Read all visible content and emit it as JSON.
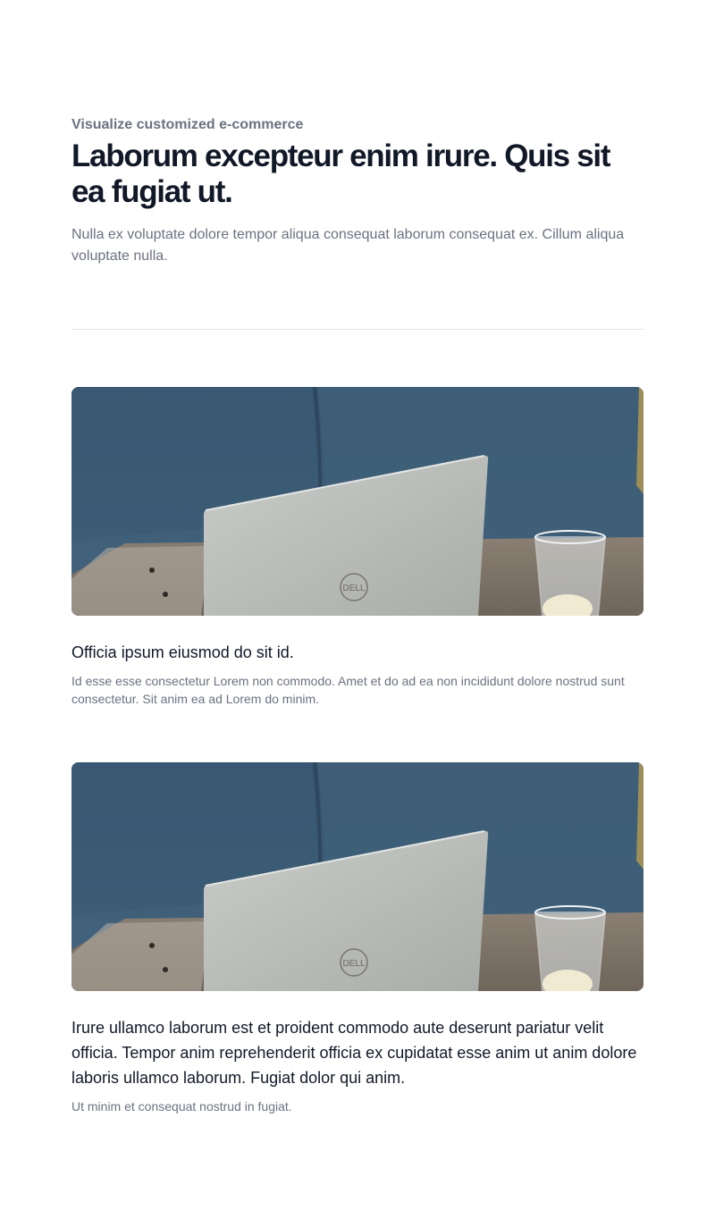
{
  "header": {
    "eyebrow": "Visualize customized e-commerce",
    "title": "Laborum excepteur enim irure. Quis sit ea fugiat ut.",
    "description": "Nulla ex voluptate dolore tempor aliqua consequat laborum consequat ex. Cillum aliqua voluptate nulla."
  },
  "cards": [
    {
      "image_logo_text": "DELL",
      "title": "Officia ipsum eiusmod do sit id.",
      "description": "Id esse esse consectetur Lorem non commodo. Amet et do ad ea non incididunt dolore nostrud sunt consectetur. Sit anim ea ad Lorem do minim."
    },
    {
      "image_logo_text": "DELL",
      "title": "Irure ullamco laborum est et proident commodo aute deserunt pariatur velit officia. Tempor anim reprehenderit officia ex cupidatat esse anim ut anim dolore laboris ullamco laborum. Fugiat dolor qui anim.",
      "description": "Ut minim et consequat nostrud in fugiat."
    }
  ],
  "colors": {
    "heading": "#111827",
    "muted": "#6b7280",
    "divider": "#e5e7eb",
    "sofa": "#3e5d77"
  }
}
